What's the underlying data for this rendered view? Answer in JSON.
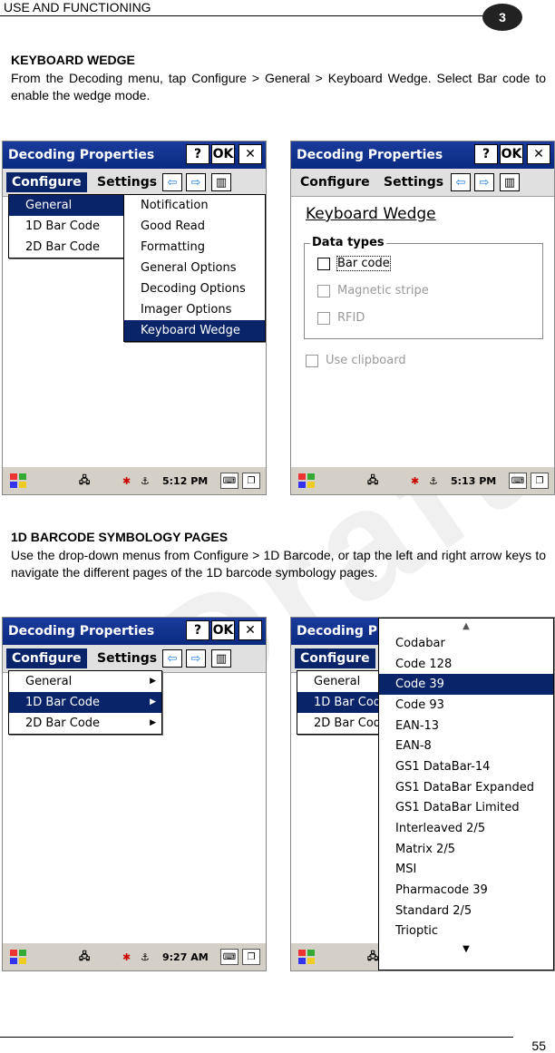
{
  "header": {
    "title": "USE AND FUNCTIONING",
    "chapter": "3"
  },
  "sections": [
    {
      "title": "KEYBOARD WEDGE",
      "text": "From the Decoding menu, tap Configure > General > Keyboard Wedge. Select Bar code to enable the wedge mode."
    },
    {
      "title": "1D BARCODE SYMBOLOGY PAGES",
      "text": "Use the drop-down menus from Configure > 1D Barcode, or tap the left and right arrow keys to navigate the different pages of the 1D barcode symbology pages."
    }
  ],
  "app": {
    "title": "Decoding Properties",
    "help_btn": "?",
    "ok_btn": "OK",
    "close_btn": "✕",
    "menu_configure": "Configure",
    "menu_settings": "Settings",
    "left_arrow": "⇦",
    "right_arrow": "⇨",
    "kbd_icon": "▥"
  },
  "screen1": {
    "configure_items": [
      "General",
      "1D Bar Code",
      "2D Bar Code"
    ],
    "general_items": [
      "Notification",
      "Good Read",
      "Formatting",
      "General Options",
      "Decoding Options",
      "Imager Options",
      "Keyboard Wedge"
    ],
    "time": "5:12 PM"
  },
  "screen2": {
    "heading": "Keyboard Wedge",
    "group_label": "Data types",
    "options": [
      {
        "label": "Bar code",
        "enabled": true
      },
      {
        "label": "Magnetic stripe",
        "enabled": false
      },
      {
        "label": "RFID",
        "enabled": false
      }
    ],
    "clipboard": "Use clipboard",
    "time": "5:13 PM"
  },
  "screen3": {
    "configure_items": [
      "General",
      "1D Bar Code",
      "2D Bar Code"
    ],
    "time": "9:27 AM"
  },
  "screen4": {
    "configure_items": [
      "General",
      "1D Bar Cod",
      "2D Bar Cod"
    ],
    "title_partial": "Decoding Pro",
    "symbologies": [
      "Codabar",
      "Code 128",
      "Code 39",
      "Code 93",
      "EAN-13",
      "EAN-8",
      "GS1 DataBar-14",
      "GS1 DataBar Expanded",
      "GS1 DataBar Limited",
      "Interleaved 2/5",
      "Matrix 2/5",
      "MSI",
      "Pharmacode 39",
      "Standard 2/5",
      "Trioptic"
    ],
    "selected": "Code 39"
  },
  "footer": {
    "page": "55"
  },
  "colors": {
    "titlebar": "#0a246a",
    "selection": "#0a246a",
    "menubar": "#e0e0e0"
  }
}
